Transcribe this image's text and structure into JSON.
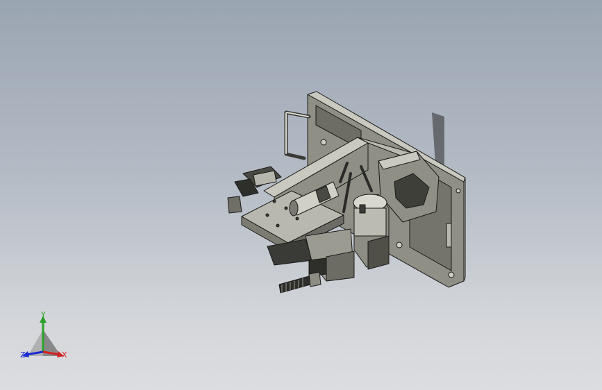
{
  "viewport": {
    "background_top": "#9aa5b2",
    "background_bottom": "#dcdde0",
    "model": {
      "parts": [
        "mounting-plate",
        "handle-bar",
        "arm-beam",
        "cylinder-actuator",
        "gripper",
        "rotary-unit",
        "spring-rod"
      ],
      "colors": {
        "body": "#8f8f86",
        "light": "#bdbdb3",
        "dark": "#3f3f3a",
        "edge": "#1a1a18"
      }
    },
    "triad": {
      "y_label": "Y",
      "x_label": "X",
      "z_label": "Z",
      "y_color": "#2aa02a",
      "x_color": "#d42020",
      "z_color": "#1a2ad0"
    }
  }
}
